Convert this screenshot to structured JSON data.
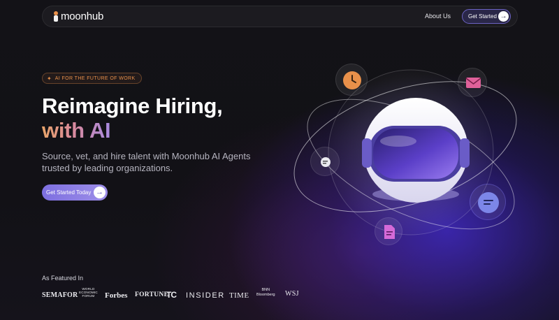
{
  "nav": {
    "logo_text": "moonhub",
    "about_label": "About Us",
    "cta_label": "Get Started",
    "cta_arrow": "→"
  },
  "hero": {
    "pill_icon": "sparkle-icon",
    "pill_text": "AI FOR THE FUTURE OF WORK",
    "headline_line1": "Reimagine Hiring,",
    "headline_line2": "with AI",
    "sub_line1": "Source, vet, and hire talent with Moonhub AI Agents",
    "sub_line2": "trusted by leading organizations.",
    "cta_label": "Get Started Today",
    "cta_arrow": "→"
  },
  "featured": {
    "title": "As Featured In",
    "logos": {
      "semafor": "SEMAFOR",
      "wef_line1": "WORLD",
      "wef_line2": "ECONOMIC",
      "wef_line3": "FORUM",
      "forbes": "Forbes",
      "fortune": "FORTUNE",
      "techcrunch": "TC",
      "insider": "INSIDER",
      "time": "TIME",
      "bnn_line1": "BNN",
      "bnn_line2": "Bloomberg",
      "wsj": "WSJ"
    }
  },
  "illustration": {
    "icons": [
      "clock-icon",
      "mail-icon",
      "chat-icon",
      "message-icon",
      "document-icon"
    ]
  },
  "colors": {
    "accent_orange": "#e8904a",
    "accent_purple": "#7d6fe0",
    "pink_icon": "#e0619a",
    "blue_glow": "#3c28be"
  }
}
